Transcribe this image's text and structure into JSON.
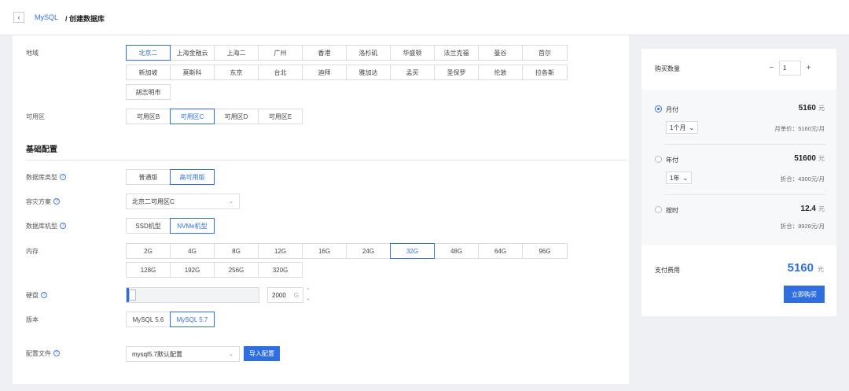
{
  "header": {
    "breadcrumb_app": "MySQL",
    "breadcrumb_page": "/ 创建数据库"
  },
  "labels": {
    "region": "地域",
    "zone": "可用区",
    "basic_config": "基础配置",
    "db_type": "数据库类型",
    "dr_plan": "容灾方案",
    "db_machine": "数据库机型",
    "memory": "内存",
    "disk": "硬盘",
    "version": "版本",
    "config_file": "配置文件"
  },
  "regions_row1": [
    "北京二",
    "上海金融云",
    "上海二",
    "广州",
    "香港",
    "洛杉矶",
    "华盛顿",
    "法兰克福",
    "曼谷",
    "首尔"
  ],
  "regions_row2": [
    "新加坡",
    "莫斯科",
    "东京",
    "台北",
    "迪拜",
    "雅加达",
    "孟买",
    "圣保罗",
    "伦敦",
    "拉各斯"
  ],
  "regions_row3": [
    "胡志明市"
  ],
  "zones": [
    "可用区B",
    "可用区C",
    "可用区D",
    "可用区E"
  ],
  "db_types": [
    "普通版",
    "高可用版"
  ],
  "dr_plan_value": "北京二可用区C",
  "machines": [
    "SSD机型",
    "NVMe机型"
  ],
  "memory_row1": [
    "2G",
    "4G",
    "8G",
    "12G",
    "16G",
    "24G",
    "32G",
    "48G",
    "64G",
    "96G"
  ],
  "memory_row2": [
    "128G",
    "192G",
    "256G",
    "320G"
  ],
  "disk": {
    "value": "2000",
    "unit": "G",
    "fraction": 0.02
  },
  "versions": [
    "MySQL 5.6",
    "MySQL 5.7"
  ],
  "config_file_value": "mysql5.7默认配置",
  "import_btn": "导入配置",
  "side": {
    "qty_label": "购买数量",
    "qty_value": "1",
    "minus": "−",
    "plus": "+",
    "monthly": {
      "name": "月付",
      "price": "5160",
      "unit": "元",
      "period": "1个月",
      "note": "月单价：5160元/月"
    },
    "yearly": {
      "name": "年付",
      "price": "51600",
      "unit": "元",
      "period": "1年",
      "note": "折合：4300元/月"
    },
    "hourly": {
      "name": "按时",
      "price": "12.4",
      "unit": "元",
      "note": "折合：8928元/月"
    },
    "pay_label": "支付费用",
    "pay_total": "5160",
    "pay_unit": "元",
    "buy_btn": "立即购买"
  }
}
